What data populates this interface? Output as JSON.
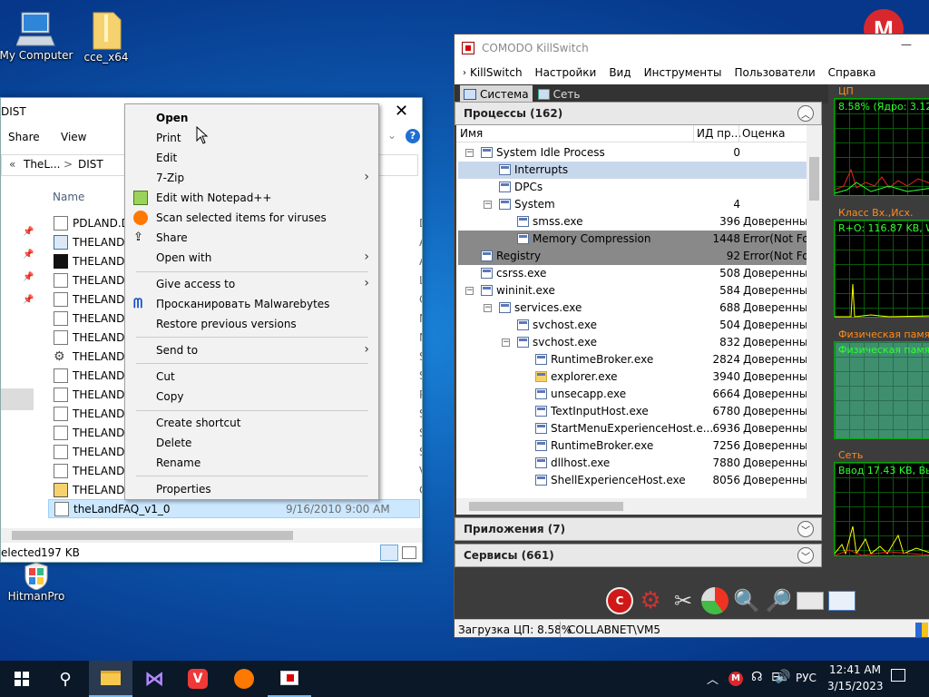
{
  "desktop": {
    "icons": [
      {
        "label": "My Computer",
        "icon": "computer-icon"
      },
      {
        "label": "cce_x64",
        "icon": "folder-zip-icon"
      },
      {
        "label": "HitmanPro",
        "icon": "hitmanpro-icon"
      }
    ]
  },
  "explorer": {
    "title": "DIST",
    "ribbon": [
      "Share",
      "View"
    ],
    "address": [
      "«",
      "TheL...",
      ">",
      "DIST"
    ],
    "column_name": "Name",
    "files": [
      {
        "name": "PDLAND.DO",
        "col": "D",
        "icon": "document-icon"
      },
      {
        "name": "THELAND",
        "col": "A",
        "icon": "app-window-icon"
      },
      {
        "name": "THELAND",
        "col": "A",
        "icon": "dark-app-icon"
      },
      {
        "name": "THELAND.L",
        "col": "L",
        "icon": "file-icon"
      },
      {
        "name": "THELAND",
        "col": "C",
        "icon": "text-document-icon"
      },
      {
        "name": "THELAND.N",
        "col": "N",
        "icon": "file-icon"
      },
      {
        "name": "THELAND.N",
        "col": "N",
        "icon": "file-icon"
      },
      {
        "name": "THELAND",
        "col": "S",
        "icon": "settings-file-icon"
      },
      {
        "name": "THELAND",
        "col": "S",
        "icon": "system-file-icon"
      },
      {
        "name": "THELAND.P",
        "col": "P",
        "icon": "file-icon"
      },
      {
        "name": "THELAND.S",
        "col": "S",
        "icon": "file-icon"
      },
      {
        "name": "THELAND.S",
        "col": "S",
        "icon": "file-icon"
      },
      {
        "name": "THELAND.S",
        "col": "S",
        "icon": "file-icon"
      },
      {
        "name": "THELAND.V",
        "col": "V",
        "icon": "file-icon"
      },
      {
        "name": "THELAND",
        "col": "C",
        "icon": "shortcut-file-icon"
      }
    ],
    "selected_file": {
      "name": "theLandFAQ_v1_0",
      "date": "9/16/2010 9:00 AM"
    },
    "status": {
      "selected": "elected",
      "size": "197 KB"
    }
  },
  "context_menu": [
    {
      "label": "Open",
      "bold": true
    },
    {
      "label": "Print"
    },
    {
      "label": "Edit"
    },
    {
      "label": "7-Zip",
      "submenu": true
    },
    {
      "label": "Edit with Notepad++",
      "icon": "notepad-plus-icon"
    },
    {
      "label": "Scan selected items for viruses",
      "icon": "avast-icon"
    },
    {
      "label": "Share",
      "icon": "share-icon"
    },
    {
      "label": "Open with",
      "submenu": true
    },
    {
      "label": "Give access to",
      "submenu": true
    },
    {
      "label": "Просканировать Malwarebytes",
      "icon": "malwarebytes-icon"
    },
    {
      "label": "Restore previous versions"
    },
    {
      "label": "Send to",
      "submenu": true
    },
    {
      "label": "Cut"
    },
    {
      "label": "Copy"
    },
    {
      "label": "Create shortcut"
    },
    {
      "label": "Delete"
    },
    {
      "label": "Rename"
    },
    {
      "label": "Properties"
    }
  ],
  "killswitch": {
    "title": "COMODO KillSwitch",
    "menu": [
      "KillSwitch",
      "Настройки",
      "Вид",
      "Инструменты",
      "Пользователи",
      "Справка"
    ],
    "tabs": [
      "Система",
      "Сеть"
    ],
    "processes_header": "Процессы (162)",
    "columns": [
      "Имя",
      "ИД пр...",
      "Оценка"
    ],
    "processes": [
      {
        "name": "System Idle Process",
        "pid": "0",
        "rating": ""
      },
      {
        "name": "Interrupts",
        "pid": "",
        "rating": ""
      },
      {
        "name": "DPCs",
        "pid": "",
        "rating": ""
      },
      {
        "name": "System",
        "pid": "4",
        "rating": ""
      },
      {
        "name": "smss.exe",
        "pid": "396",
        "rating": "Доверенный"
      },
      {
        "name": "Memory Compression",
        "pid": "1448",
        "rating": "Error(Not Fo..."
      },
      {
        "name": "Registry",
        "pid": "92",
        "rating": "Error(Not Fo..."
      },
      {
        "name": "csrss.exe",
        "pid": "508",
        "rating": "Доверенный"
      },
      {
        "name": "wininit.exe",
        "pid": "584",
        "rating": "Доверенный"
      },
      {
        "name": "services.exe",
        "pid": "688",
        "rating": "Доверенный"
      },
      {
        "name": "svchost.exe",
        "pid": "504",
        "rating": "Доверенный"
      },
      {
        "name": "svchost.exe",
        "pid": "832",
        "rating": "Доверенный"
      },
      {
        "name": "RuntimeBroker.exe",
        "pid": "2824",
        "rating": "Доверенный"
      },
      {
        "name": "explorer.exe",
        "pid": "3940",
        "rating": "Доверенный"
      },
      {
        "name": "unsecapp.exe",
        "pid": "6664",
        "rating": "Доверенный"
      },
      {
        "name": "TextInputHost.exe",
        "pid": "6780",
        "rating": "Доверенный"
      },
      {
        "name": "StartMenuExperienceHost.e...",
        "pid": "6936",
        "rating": "Доверенный"
      },
      {
        "name": "RuntimeBroker.exe",
        "pid": "7256",
        "rating": "Доверенный"
      },
      {
        "name": "dllhost.exe",
        "pid": "7880",
        "rating": "Доверенный"
      },
      {
        "name": "ShellExperienceHost.exe",
        "pid": "8056",
        "rating": "Доверенный"
      }
    ],
    "apps_header": "Приложения (7)",
    "services_header": "Сервисы (661)",
    "graphs": {
      "cpu_label": "ЦП",
      "cpu_text": "8.58% (Ядро: 3.12%",
      "net_label": "Класс Вх.,Исх.",
      "net_text": "R+O: 116.87 KB, W",
      "mem_label": "Физическая памят",
      "mem_text": "Физическая памят",
      "netw_label": "Сеть",
      "netw_text": "Ввод 17.43 KB, Выв"
    },
    "status": {
      "cpu_load": "Загрузка ЦП: 8.58%",
      "user": "COLLABNET\\VM5"
    }
  },
  "taskbar": {
    "time": "12:41 AM",
    "date": "3/15/2023",
    "lang": "РУС"
  },
  "colors": {
    "selection": "#cce8ff",
    "graph_green": "#2eff2e",
    "graph_label": "#ff8c1a"
  }
}
